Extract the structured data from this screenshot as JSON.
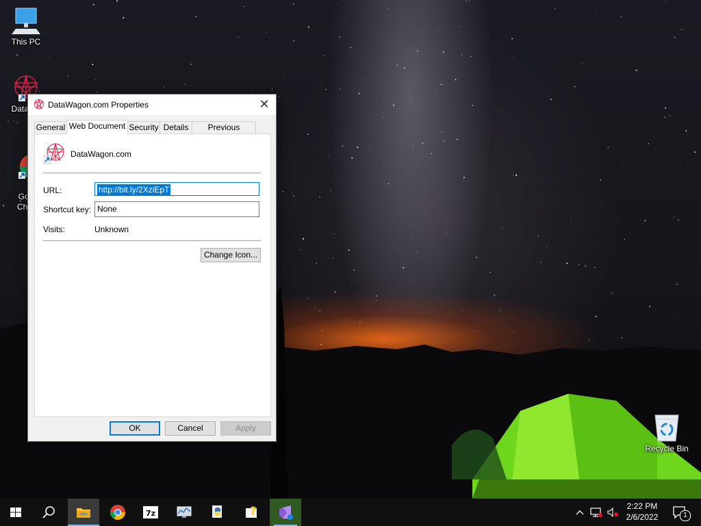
{
  "desktop": {
    "icons": [
      {
        "label": "This PC",
        "icon": "computer-icon"
      },
      {
        "label": "DataWa",
        "icon": "datawagon-icon"
      },
      {
        "label": "Goo\nChro",
        "icon": "chrome-icon"
      },
      {
        "label": "Recycle Bin",
        "icon": "recycle-bin-icon"
      }
    ]
  },
  "dialog": {
    "title": "DataWagon.com Properties",
    "close_glyph": "✕",
    "tabs": [
      {
        "label": "General"
      },
      {
        "label": "Web Document",
        "active": true
      },
      {
        "label": "Security"
      },
      {
        "label": "Details"
      },
      {
        "label": "Previous Versions"
      }
    ],
    "document_name": "DataWagon.com",
    "url_label": "URL:",
    "url_value": "http://bit.ly/2XziEpT",
    "shortcut_label": "Shortcut key:",
    "shortcut_value": "None",
    "visits_label": "Visits:",
    "visits_value": "Unknown",
    "change_icon_label": "Change Icon...",
    "ok_label": "OK",
    "cancel_label": "Cancel",
    "apply_label": "Apply"
  },
  "taskbar": {
    "apps": [
      {
        "name": "start-button",
        "icon": "windows-icon"
      },
      {
        "name": "search-button",
        "icon": "search-icon"
      },
      {
        "name": "file-explorer",
        "icon": "folder-icon",
        "state": "active"
      },
      {
        "name": "chrome",
        "icon": "chrome-icon"
      },
      {
        "name": "7zip",
        "icon": "7z-icon",
        "text": "7z"
      },
      {
        "name": "task-manager",
        "icon": "monitor-icon"
      },
      {
        "name": "python",
        "icon": "python-icon"
      },
      {
        "name": "help",
        "icon": "help-icon"
      },
      {
        "name": "visual-studio",
        "icon": "visual-studio-icon",
        "state": "open"
      }
    ],
    "tray": {
      "time": "2:22 PM",
      "date": "2/6/2022",
      "notification_count": "1"
    }
  },
  "colors": {
    "accent": "#0078d7",
    "taskbar": "#101010"
  }
}
